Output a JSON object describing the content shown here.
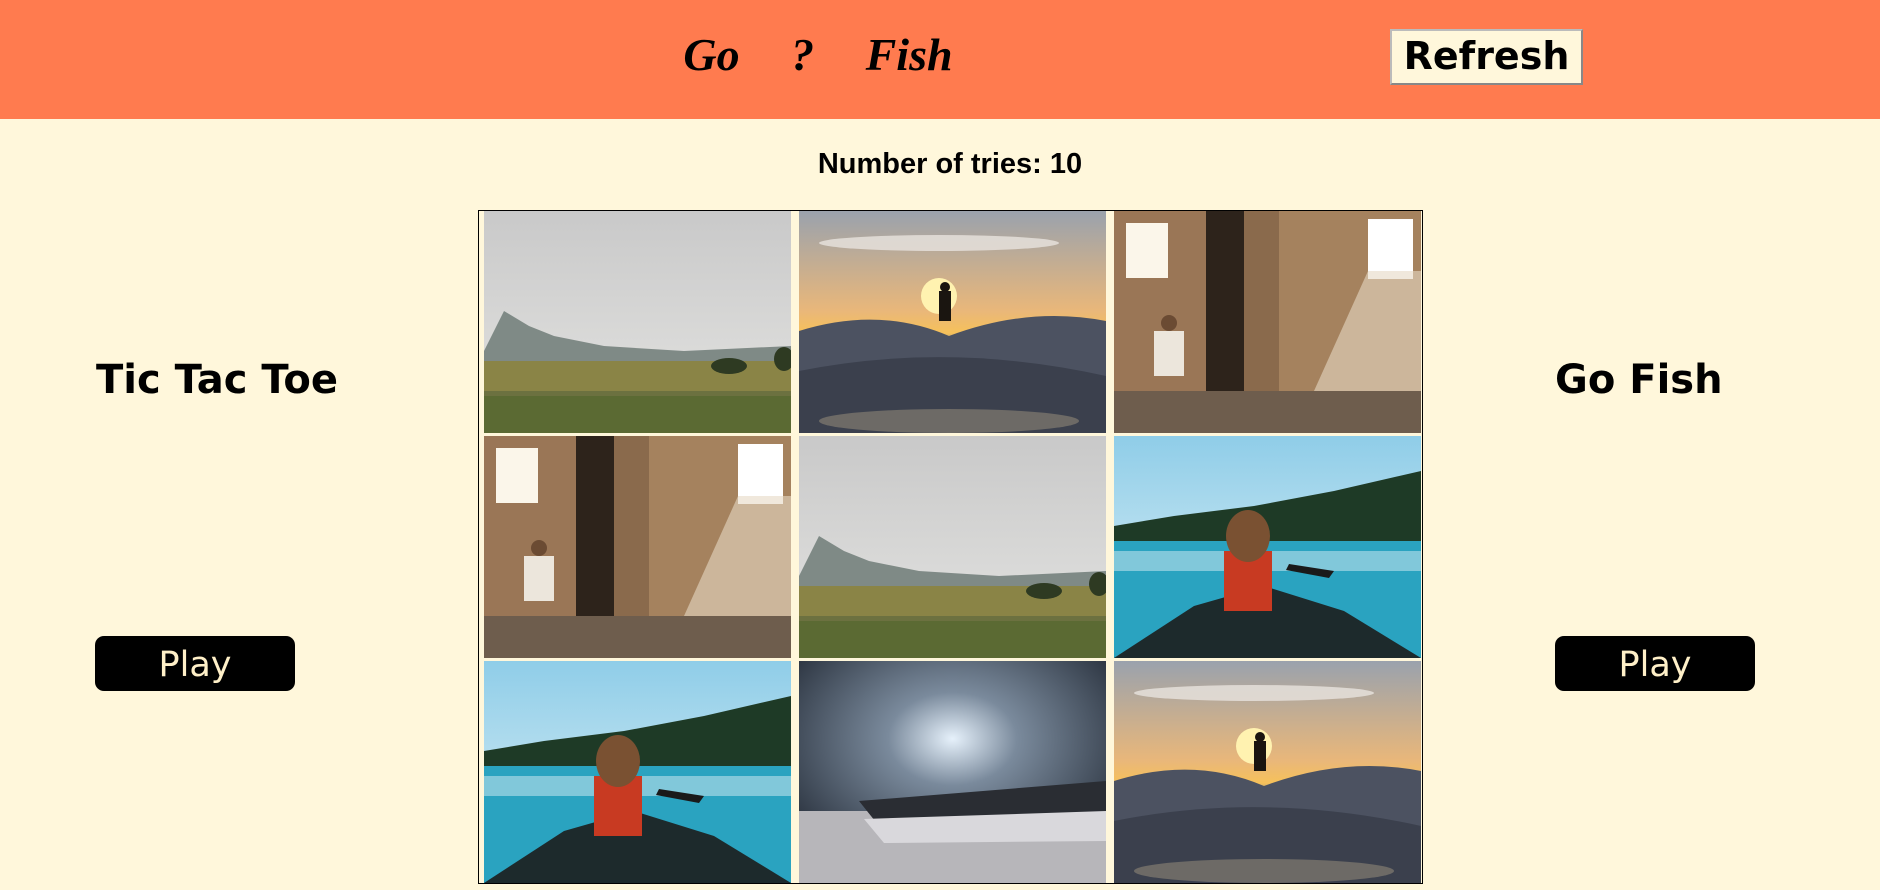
{
  "header": {
    "title": "Go ? Fish",
    "refresh_label": "Refresh"
  },
  "status": {
    "tries_text": "Number of tries: 10"
  },
  "left_panel": {
    "title": "Tic Tac Toe",
    "play_label": "Play"
  },
  "right_panel": {
    "title": "Go Fish",
    "play_label": "Play"
  },
  "board": {
    "tiles": [
      "meadow",
      "skatepark",
      "sunlit-room",
      "sunlit-room",
      "meadow",
      "canoe-lake",
      "canoe-lake",
      "phone-closeup",
      "skatepark"
    ]
  },
  "colors": {
    "header_bg": "#ff7b4f",
    "page_bg": "#fff7db",
    "button_bg": "#000000",
    "button_text": "#fff0c8"
  }
}
